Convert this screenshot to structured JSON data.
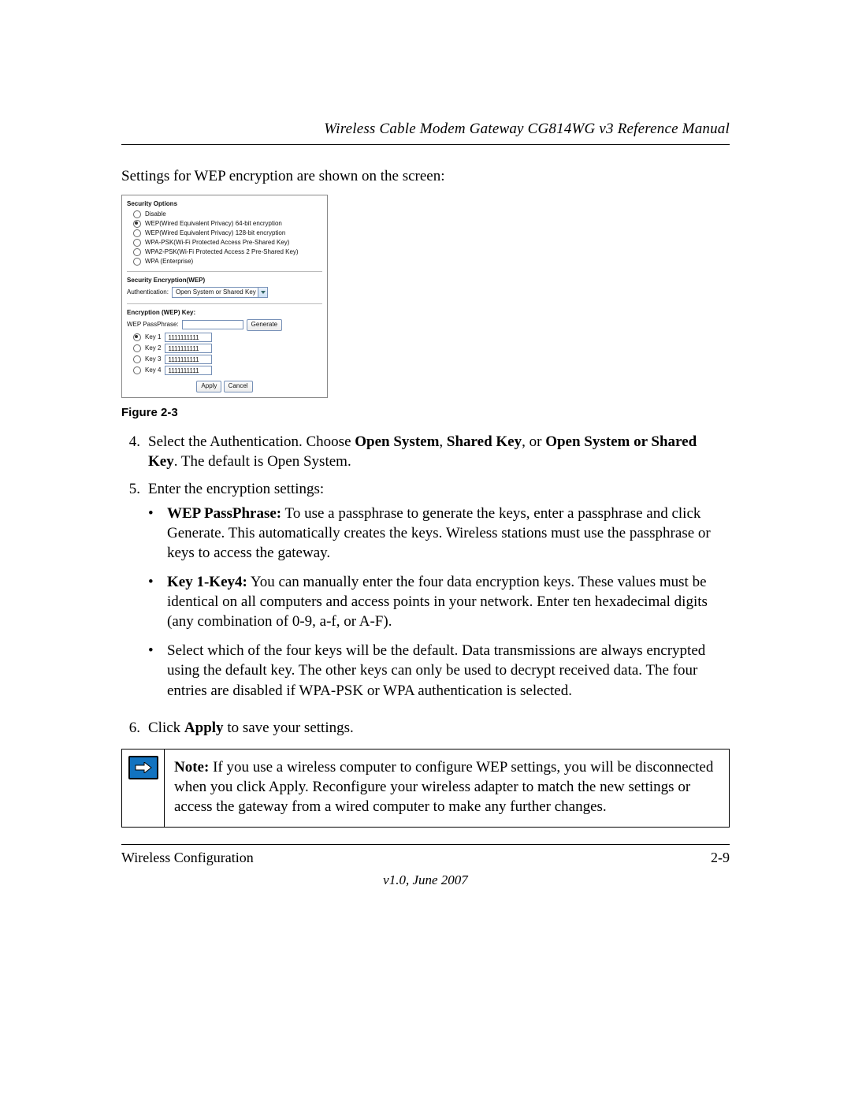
{
  "header": {
    "title": "Wireless Cable Modem Gateway CG814WG v3 Reference Manual"
  },
  "intro": "Settings for WEP encryption are shown on the screen:",
  "shot": {
    "sec_options_hdr": "Security Options",
    "opts": {
      "disable": "Disable",
      "wep64": "WEP(Wired Equivalent Privacy) 64-bit encryption",
      "wep128": "WEP(Wired Equivalent Privacy) 128-bit encryption",
      "wpapsk": "WPA-PSK(Wi-Fi Protected Access Pre-Shared Key)",
      "wpa2psk": "WPA2-PSK(Wi-Fi Protected Access 2 Pre-Shared Key)",
      "wpaent": "WPA (Enterprise)"
    },
    "enc_hdr": "Security Encryption(WEP)",
    "auth_label": "Authentication:",
    "auth_value": "Open System or Shared Key",
    "enc_key_hdr": "Encryption (WEP) Key:",
    "pass_label": "WEP PassPhrase:",
    "pass_value": "",
    "generate": "Generate",
    "key1_lbl": "Key 1",
    "key1_val": "1111111111",
    "key2_lbl": "Key 2",
    "key2_val": "1111111111",
    "key3_lbl": "Key 3",
    "key3_val": "1111111111",
    "key4_lbl": "Key 4",
    "key4_val": "1111111111",
    "apply": "Apply",
    "cancel": "Cancel"
  },
  "fig": "Figure 2-3",
  "steps": {
    "s4_num": "4.",
    "s4_a": "Select the Authentication. Choose ",
    "s4_b1": "Open System",
    "s4_comma": ", ",
    "s4_b2": "Shared Key",
    "s4_or": ", or ",
    "s4_b3": "Open System or Shared Key",
    "s4_c": ". The default is Open System.",
    "s5_num": "5.",
    "s5_txt": "Enter the encryption settings:",
    "b1_lbl": "WEP PassPhrase:",
    "b1_txt": " To use a passphrase to generate the keys, enter a passphrase and click Generate. This automatically creates the keys. Wireless stations must use the passphrase or keys to access the gateway.",
    "b2_lbl": "Key 1-Key4:",
    "b2_txt": " You can manually enter the four data encryption keys. These values must be identical on all computers and access points in your network. Enter ten hexadecimal digits (any combination of 0-9, a-f, or A-F).",
    "b3_txt": "Select which of the four keys will be the default. Data transmissions are always encrypted using the default key. The other keys can only be used to decrypt received data. The four entries are disabled if WPA-PSK or WPA authentication is selected.",
    "s6_num": "6.",
    "s6_a": "Click ",
    "s6_b": "Apply",
    "s6_c": " to save your settings."
  },
  "note": {
    "label": "Note:",
    "text": " If you use a wireless computer to configure WEP settings, you will be disconnected when you click Apply. Reconfigure your wireless adapter to match the new settings or access the gateway from a wired computer to make any further changes."
  },
  "footer": {
    "left": "Wireless Configuration",
    "right": "2-9",
    "version": "v1.0, June 2007"
  }
}
